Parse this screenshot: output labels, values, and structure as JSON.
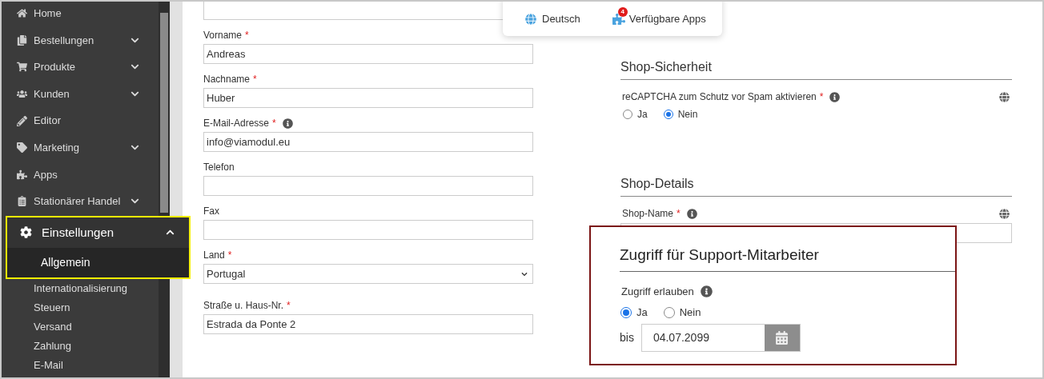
{
  "sidebar": {
    "items": [
      {
        "label": "Home"
      },
      {
        "label": "Bestellungen",
        "expanded": false
      },
      {
        "label": "Produkte",
        "expanded": false
      },
      {
        "label": "Kunden",
        "expanded": false
      },
      {
        "label": "Editor"
      },
      {
        "label": "Marketing",
        "expanded": false
      },
      {
        "label": "Apps"
      },
      {
        "label": "Stationärer Handel",
        "expanded": false
      },
      {
        "label": "Einstellungen",
        "expanded": true,
        "highlighted": true,
        "children": [
          {
            "label": "Allgemein",
            "selected": true
          },
          {
            "label": "Internationalisierung",
            "selected": false
          },
          {
            "label": "Steuern",
            "selected": false
          },
          {
            "label": "Versand",
            "selected": false
          },
          {
            "label": "Zahlung",
            "selected": false
          },
          {
            "label": "E-Mail",
            "selected": false
          }
        ]
      }
    ]
  },
  "toolbar": {
    "items": [
      {
        "label": "Deutsch",
        "kind": "language"
      },
      {
        "label": "Verfügbare Apps",
        "kind": "apps",
        "badge": "4"
      }
    ]
  },
  "form": {
    "fields": [
      {
        "kind": "text"
      },
      {
        "label": "Vorname",
        "required": "*",
        "info": false,
        "kind": "text",
        "value": "Andreas"
      },
      {
        "label": "Nachname",
        "required": "*",
        "info": false,
        "kind": "text",
        "value": "Huber"
      },
      {
        "label": "E-Mail-Adresse",
        "required": "*",
        "info": true,
        "kind": "text",
        "value": "info@viamodul.eu"
      },
      {
        "label": "Telefon",
        "info": false,
        "kind": "text"
      },
      {
        "label": "Fax",
        "info": false,
        "kind": "text"
      },
      {
        "label": "Land",
        "required": "*",
        "info": false,
        "kind": "select",
        "value": "Portugal"
      },
      {
        "label": "Straße u. Haus-Nr.",
        "required": "*",
        "info": false,
        "kind": "text",
        "value": "Estrada da Ponte 2"
      }
    ]
  },
  "sections": [
    {
      "title": "Shop-Sicherheit",
      "field": {
        "label": "reCAPTCHA zum Schutz vor Spam aktivieren",
        "required": "*",
        "info": true,
        "kind": "radio",
        "options": [
          {
            "label": "Ja",
            "selected": false
          },
          {
            "label": "Nein",
            "selected": true
          }
        ]
      }
    },
    {
      "title": "Shop-Details",
      "field": {
        "label": "Shop-Name",
        "required": "*",
        "info": true,
        "kind": "text"
      }
    }
  ],
  "callout": {
    "title": "Zugriff für Support-Mitarbeiter",
    "label": "Zugriff erlauben",
    "info": true,
    "options": [
      {
        "label": "Ja",
        "selected": true
      },
      {
        "label": "Nein",
        "selected": false
      }
    ],
    "until_label": "bis",
    "date": "04.07.2099"
  }
}
